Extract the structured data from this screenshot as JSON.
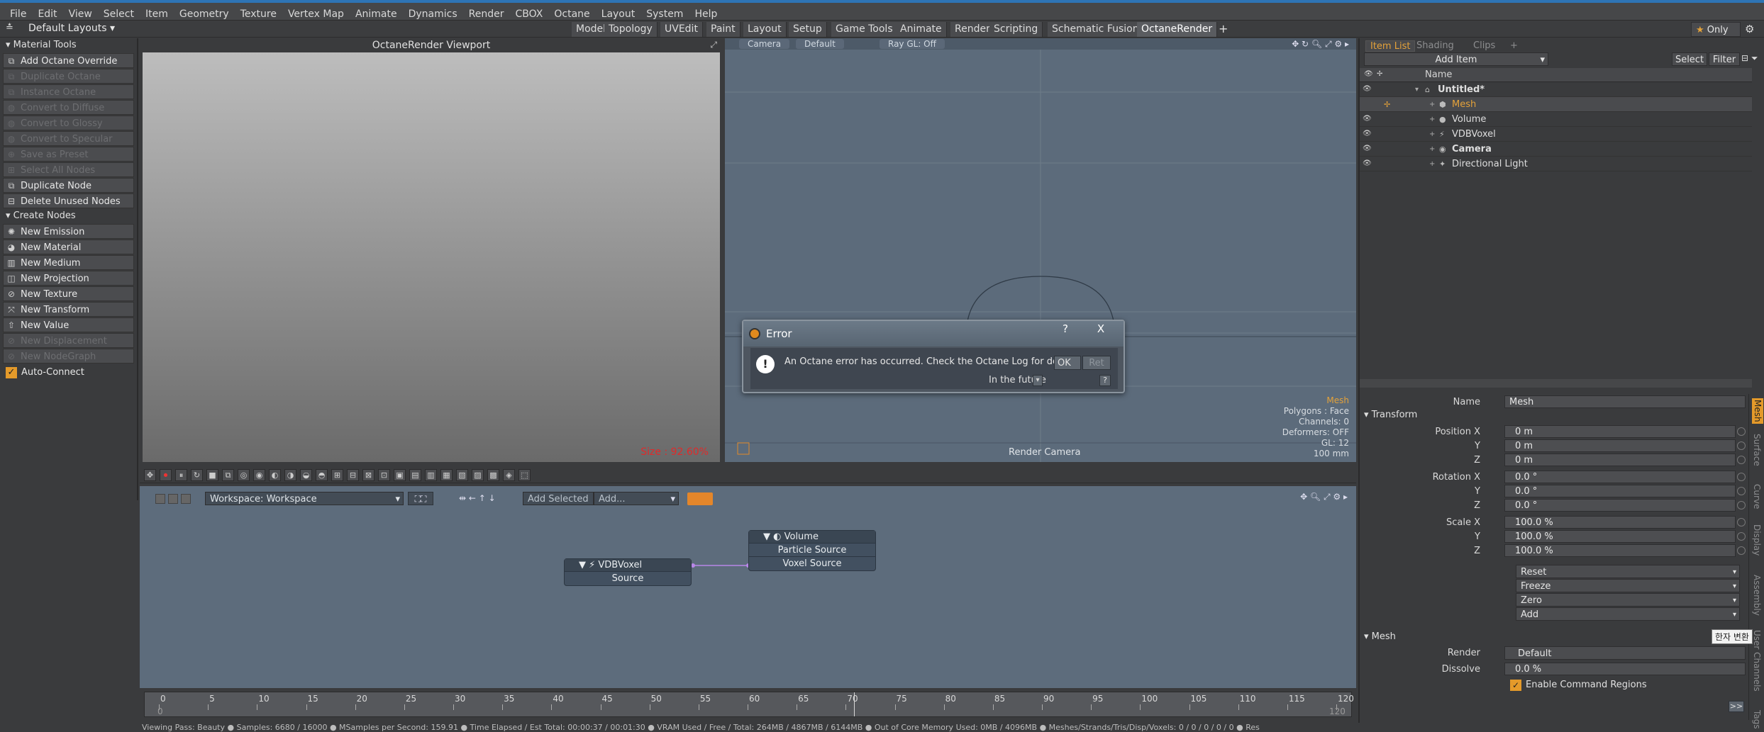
{
  "menubar": {
    "items": [
      "File",
      "Edit",
      "View",
      "Select",
      "Item",
      "Geometry",
      "Texture",
      "Vertex Map",
      "Animate",
      "Dynamics",
      "Render",
      "CBOX",
      "Octane",
      "Layout",
      "System",
      "Help"
    ]
  },
  "layoutbar": {
    "layout_label": "Default Layouts",
    "tabs": [
      "Model",
      "Topology",
      "UVEdit",
      "Paint",
      "Layout",
      "Setup",
      "Game Tools",
      "Animate",
      "Render",
      "Scripting",
      "Schematic Fusion",
      "OctaneRender"
    ],
    "active_tab": "OctaneRender",
    "add_tab": "+",
    "only_label": "Only"
  },
  "left_panel": {
    "material_tools_title": "Material Tools",
    "material_tools": [
      {
        "label": "Add Octane Override",
        "enabled": true
      },
      {
        "label": "Duplicate Octane Override",
        "enabled": false
      },
      {
        "label": "Instance Octane Override",
        "enabled": false
      },
      {
        "label": "Convert to Diffuse",
        "enabled": false
      },
      {
        "label": "Convert to Glossy",
        "enabled": false
      },
      {
        "label": "Convert to Specular",
        "enabled": false
      },
      {
        "label": "Save as Preset",
        "enabled": false
      },
      {
        "label": "Select All Nodes",
        "enabled": false
      },
      {
        "label": "Duplicate Node",
        "enabled": true
      },
      {
        "label": "Delete Unused Nodes",
        "enabled": true
      }
    ],
    "create_nodes_title": "Create Nodes",
    "create_nodes": [
      {
        "label": "New Emission",
        "enabled": true
      },
      {
        "label": "New Material",
        "enabled": true
      },
      {
        "label": "New Medium",
        "enabled": true
      },
      {
        "label": "New Projection",
        "enabled": true
      },
      {
        "label": "New Texture",
        "enabled": true
      },
      {
        "label": "New Transform",
        "enabled": true
      },
      {
        "label": "New Value",
        "enabled": true
      },
      {
        "label": "New Displacement",
        "enabled": false
      },
      {
        "label": "New NodeGraph",
        "enabled": false
      }
    ],
    "auto_connect": "Auto-Connect"
  },
  "render_viewport": {
    "title": "OctaneRender Viewport",
    "size_text": "Size : 92.60%"
  },
  "scene_viewport": {
    "camera": "Camera",
    "default": "Default",
    "raygl": "Ray GL: Off",
    "info": [
      "Mesh",
      "Polygons : Face",
      "Channels: 0",
      "Deformers: OFF",
      "GL: 12",
      "100 mm"
    ],
    "render_camera": "Render Camera"
  },
  "dialog": {
    "title": "Error",
    "message": "An Octane error has occurred.  Check the Octane Log for details.",
    "ok": "OK",
    "ret": "Ret",
    "future_label": "In the future",
    "help": "?",
    "close": "X"
  },
  "node_editor": {
    "workspace": "Workspace: Workspace",
    "add_selected": "Add Selected",
    "add": "Add...",
    "nodes": {
      "volume": {
        "title": "Volume",
        "ports": [
          "Particle Source",
          "Voxel Source"
        ]
      },
      "vdbvoxel": {
        "title": "VDBVoxel",
        "ports": [
          "Source"
        ]
      }
    }
  },
  "timeline": {
    "ticks": [
      "0",
      "5",
      "10",
      "15",
      "20",
      "25",
      "30",
      "35",
      "40",
      "45",
      "50",
      "55",
      "60",
      "65",
      "70",
      "75",
      "80",
      "85",
      "90",
      "95",
      "100",
      "105",
      "110",
      "115",
      "120"
    ],
    "start": "0",
    "end": "120"
  },
  "status": "Viewing Pass: Beauty ●  Samples: 6680 / 16000 ●  MSamples per Second: 159.91 ●  Time Elapsed / Est Total: 00:00:37 / 00:01:30 ●  VRAM Used / Free / Total: 264MB / 4867MB / 6144MB ●  Out of Core Memory Used: 0MB / 4096MB ●  Meshes/Strands/Tris/Disp/Voxels: 0 / 0 / 0 / 0 / 0 ●  Res",
  "right_panel": {
    "tabs": [
      "Item List",
      "Shading",
      "Clips",
      "+"
    ],
    "active_tab": "Item List",
    "add_item": "Add Item",
    "select": "Select",
    "filter": "Filter",
    "name_col": "Name",
    "items": [
      {
        "label": "Untitled*",
        "indent": 0,
        "bold": true,
        "selected": false
      },
      {
        "label": "Mesh",
        "indent": 1,
        "bold": false,
        "selected": true
      },
      {
        "label": "Volume",
        "indent": 1,
        "bold": false,
        "selected": false
      },
      {
        "label": "VDBVoxel",
        "indent": 1,
        "bold": false,
        "selected": false
      },
      {
        "label": "Camera",
        "indent": 1,
        "bold": true,
        "selected": false
      },
      {
        "label": "Directional Light",
        "indent": 1,
        "bold": false,
        "selected": false
      }
    ],
    "props": {
      "name_label": "Name",
      "name_value": "Mesh",
      "transform_title": "Transform",
      "position_label": "Position X",
      "rotation_label": "Rotation X",
      "scale_label": "Scale X",
      "y_label": "Y",
      "z_label": "Z",
      "pos": [
        "0 m",
        "0 m",
        "0 m"
      ],
      "rot": [
        "0.0 °",
        "0.0 °",
        "0.0 °"
      ],
      "scale": [
        "100.0 %",
        "100.0 %",
        "100.0 %"
      ],
      "actions": [
        "Reset",
        "Freeze",
        "Zero",
        "Add"
      ],
      "mesh_title": "Mesh",
      "render_label": "Render",
      "render_value": "Default",
      "dissolve_label": "Dissolve",
      "dissolve_value": "0.0 %",
      "enable_cmd": "Enable Command Regions",
      "more": ">>",
      "vtabs": [
        "Mesh",
        "Surface",
        "Curve",
        "Display",
        "Assembly",
        "User Channels",
        "Tags"
      ],
      "ime_tooltip": "한자 변환"
    }
  }
}
